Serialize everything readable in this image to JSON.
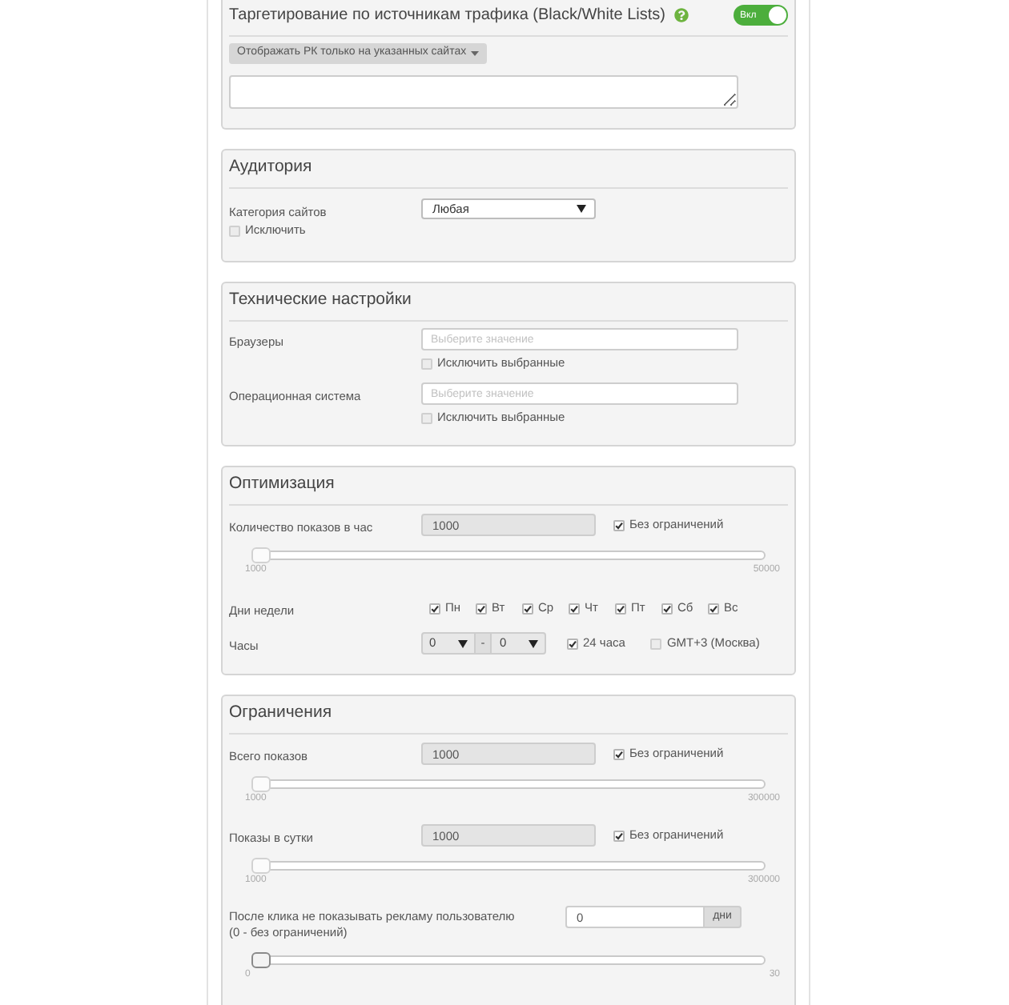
{
  "sections": [
    {
      "kind": "targeting",
      "title": "Таргетирование по источникам трафика (Black/White Lists)",
      "switch": {
        "label": "Вкл",
        "on": true
      },
      "mode_dropdown": {
        "label": "Отображать РК только на указанных сайтах"
      }
    },
    {
      "kind": "form",
      "title": "Аудитория",
      "rows": [
        {
          "kind": "select",
          "label": "Категория сайтов",
          "value": "Любая",
          "exclude": {
            "label": "Исключить",
            "checked": false
          }
        }
      ]
    },
    {
      "kind": "form",
      "title": "Технические настройки",
      "rows": [
        {
          "kind": "multiselect",
          "label": "Браузеры",
          "placeholder": "Выберите значение",
          "exclude": {
            "label": "Исключить выбранные",
            "checked": false
          }
        },
        {
          "kind": "multiselect",
          "label": "Операционная система",
          "placeholder": "Выберите значение",
          "exclude": {
            "label": "Исключить выбранные",
            "checked": false
          }
        }
      ]
    },
    {
      "kind": "form",
      "title": "Оптимизация",
      "rows": [
        {
          "kind": "limit",
          "label": "Количество показов в час",
          "value": "1000",
          "disabled": true,
          "unlimited": {
            "label": "Без ограничений",
            "checked": true
          },
          "slider": {
            "level": 0,
            "disabled": true,
            "min_label": "1000",
            "max_label": "50000"
          }
        },
        {
          "kind": "days",
          "label": "Дни недели",
          "days": [
            {
              "label": "Пн",
              "checked": true
            },
            {
              "label": "Вт",
              "checked": true
            },
            {
              "label": "Ср",
              "checked": true
            },
            {
              "label": "Чт",
              "checked": true
            },
            {
              "label": "Пт",
              "checked": true
            },
            {
              "label": "Сб",
              "checked": true
            },
            {
              "label": "Вс",
              "checked": true
            }
          ]
        },
        {
          "kind": "hours",
          "label": "Часы",
          "from": "0",
          "separator": "-",
          "to": "0",
          "options": [
            {
              "label": "24 часа",
              "checked": true
            },
            {
              "label": "GMT+3 (Москва)",
              "checked": false
            }
          ]
        }
      ]
    },
    {
      "kind": "form",
      "title": "Ограничения",
      "rows": [
        {
          "kind": "limit",
          "label": "Всего показов",
          "value": "1000",
          "disabled": true,
          "unlimited": {
            "label": "Без ограничений",
            "checked": true
          },
          "slider": {
            "level": 0,
            "disabled": true,
            "min_label": "1000",
            "max_label": "300000"
          }
        },
        {
          "kind": "limit",
          "label": "Показы в сутки",
          "value": "1000",
          "disabled": true,
          "unlimited": {
            "label": "Без ограничений",
            "checked": true
          },
          "slider": {
            "level": 0,
            "disabled": true,
            "min_label": "1000",
            "max_label": "300000"
          }
        },
        {
          "kind": "period",
          "label": "После клика не показывать рекламу пользователю",
          "note": "(0 - без ограничений)",
          "value": "0",
          "unit": "дни",
          "slider": {
            "level": 0,
            "disabled": false,
            "min_label": "0",
            "max_label": "30"
          }
        }
      ]
    }
  ]
}
